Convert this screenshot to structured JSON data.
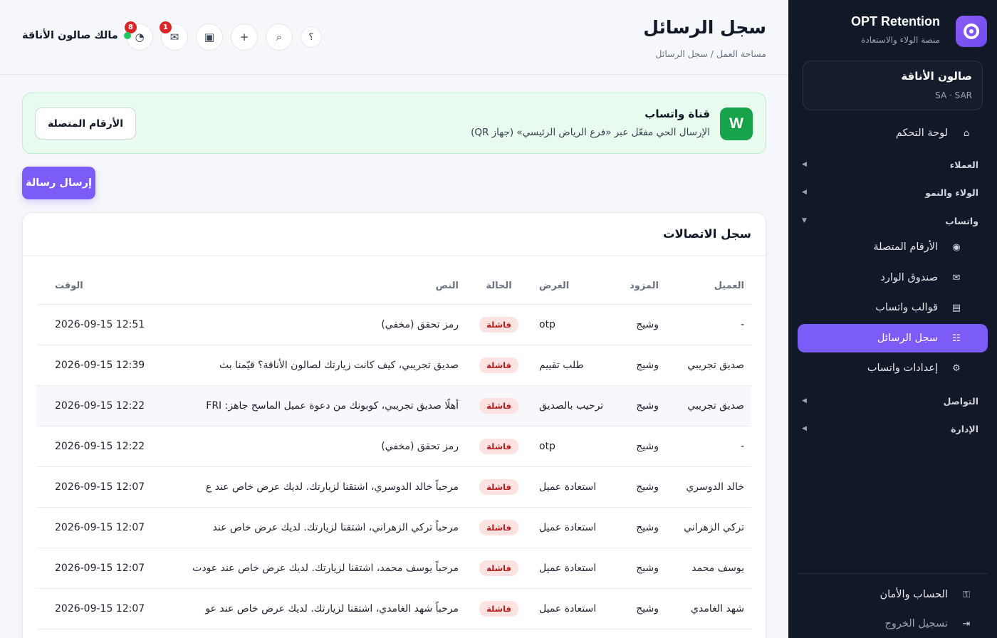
{
  "sidebar": {
    "brand_name": "OPT Retention",
    "brand_sub": "منصة الولاء والاستعادة",
    "business_name": "صالون الأناقة",
    "business_meta": "SA · SAR",
    "dashboard": "لوحة التحكم",
    "groups": {
      "customers": "العملاء",
      "loyalty": "الولاء والنمو",
      "whatsapp": "واتساب",
      "communication": "التواصل",
      "admin": "الإدارة"
    },
    "whatsapp_items": {
      "numbers": "الأرقام المتصلة",
      "inbox": "صندوق الوارد",
      "templates": "قوالب واتساب",
      "log": "سجل الرسائل",
      "settings": "إعدادات واتساب"
    },
    "account": "الحساب والأمان",
    "logout": "تسجيل الخروج"
  },
  "header": {
    "title": "سجل الرسائل",
    "breadcrumb": "مساحة العمل / سجل الرسائل",
    "owner": "مالك صالون الأناقة",
    "notifications_count": "8",
    "messages_count": "1"
  },
  "banner": {
    "icon_letter": "W",
    "title": "قناة واتساب",
    "subtitle": "الإرسال الحي مفعّل عبر «فرع الرياض الرئيسي» (جهاز QR)",
    "button": "الأرقام المتصلة"
  },
  "send_button": "إرسال رسالة",
  "log": {
    "title": "سجل الاتصالات",
    "columns": {
      "customer": "العميل",
      "provider": "المزود",
      "purpose": "الغرض",
      "status": "الحالة",
      "text": "النص",
      "time": "الوقت"
    },
    "rows": [
      {
        "customer": "-",
        "provider": "وشيج",
        "purpose": "otp",
        "status": "فاشلة",
        "text": "رمز تحقق (مخفي)",
        "time": "2026-09-15 12:51"
      },
      {
        "customer": "صديق تجريبي",
        "provider": "وشيج",
        "purpose": "طلب تقييم",
        "status": "فاشلة",
        "text": "صديق تجريبي، كيف كانت زيارتك لصالون الأناقة؟ قيّمنا بث",
        "time": "2026-09-15 12:39"
      },
      {
        "customer": "صديق تجريبي",
        "provider": "وشيج",
        "purpose": "ترحيب بالصديق",
        "status": "فاشلة",
        "text": "أهلًا صديق تجريبي، كوبونك من دعوة عميل الماسح جاهز: FRI",
        "time": "2026-09-15 12:22"
      },
      {
        "customer": "-",
        "provider": "وشيج",
        "purpose": "otp",
        "status": "فاشلة",
        "text": "رمز تحقق (مخفي)",
        "time": "2026-09-15 12:22"
      },
      {
        "customer": "خالد الدوسري",
        "provider": "وشيج",
        "purpose": "استعادة عميل",
        "status": "فاشلة",
        "text": "مرحباً خالد الدوسري، اشتقنا لزيارتك. لديك عرض خاص عند ع",
        "time": "2026-09-15 12:07"
      },
      {
        "customer": "تركي الزهراني",
        "provider": "وشيج",
        "purpose": "استعادة عميل",
        "status": "فاشلة",
        "text": "مرحباً تركي الزهراني، اشتقنا لزيارتك. لديك عرض خاص عند",
        "time": "2026-09-15 12:07"
      },
      {
        "customer": "يوسف محمد",
        "provider": "وشيج",
        "purpose": "استعادة عميل",
        "status": "فاشلة",
        "text": "مرحباً يوسف محمد، اشتقنا لزيارتك. لديك عرض خاص عند عودت",
        "time": "2026-09-15 12:07"
      },
      {
        "customer": "شهد الغامدي",
        "provider": "وشيج",
        "purpose": "استعادة عميل",
        "status": "فاشلة",
        "text": "مرحباً شهد الغامدي، اشتقنا لزيارتك. لديك عرض خاص عند عو",
        "time": "2026-09-15 12:07"
      }
    ]
  },
  "colors": {
    "accent": "#7c5cf6",
    "sidebar_bg": "#111827",
    "success": "#16a34a",
    "failed_bg": "#fde2e2",
    "failed_text": "#b91c1c"
  }
}
